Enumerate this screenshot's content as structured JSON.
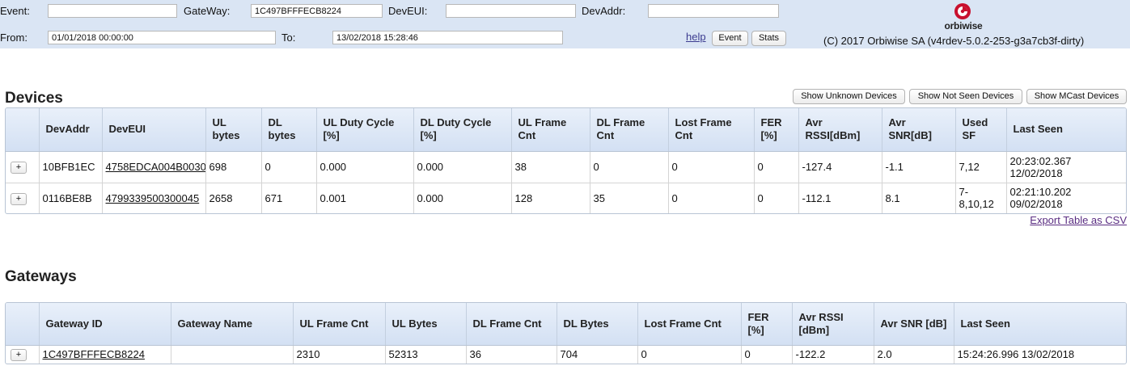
{
  "filters": {
    "event_label": "Event:",
    "event_value": "",
    "gateway_label": "GateWay:",
    "gateway_value": "1C497BFFFECB8224",
    "deveui_label": "DevEUI:",
    "deveui_value": "",
    "devaddr_label": "DevAddr:",
    "devaddr_value": "",
    "from_label": "From:",
    "from_value": "01/01/2018 00:00:00",
    "to_label": "To:",
    "to_value": "13/02/2018 15:28:46",
    "help_label": "help",
    "event_button": "Event",
    "stats_button": "Stats"
  },
  "brand": {
    "logo_text": "orbiwise",
    "copyright": "(C) 2017 Orbiwise SA (v4rdev-5.0.2-253-g3a7cb3f-dirty)",
    "logo_color": "#c8102e",
    "header_bg": "#dae5f4"
  },
  "devices": {
    "title": "Devices",
    "buttons": {
      "unknown": "Show Unknown Devices",
      "not_seen": "Show Not Seen Devices",
      "mcast": "Show MCast Devices"
    },
    "columns": [
      "DevAddr",
      "DevEUI",
      "UL bytes",
      "DL bytes",
      "DL Duty Cycle [%]",
      "DL Duty Cycle [%]",
      "UL Frame Cnt",
      "DL Frame Cnt",
      "Lost Frame Cnt",
      "FER [%]",
      "Avr RSSI[dBm]",
      "Avr SNR[dB]",
      "Used SF",
      "Last Seen"
    ],
    "rows": [
      {
        "expand": "+",
        "devaddr": "10BFB1EC",
        "deveui": "4758EDCA004B0030",
        "ul_bytes": "698",
        "dl_bytes": "0",
        "ul_duty": "0.000",
        "dl_duty": "0.000",
        "ul_frames": "38",
        "dl_frames": "0",
        "lost_frames": "0",
        "fer": "0",
        "rssi": "-127.4",
        "snr": "-1.1",
        "sf": "7,12",
        "last_seen": "20:23:02.367 12/02/2018"
      },
      {
        "expand": "+",
        "devaddr": "0116BE8B",
        "deveui": "4799339500300045",
        "ul_bytes": "2658",
        "dl_bytes": "671",
        "ul_duty": "0.001",
        "dl_duty": "0.000",
        "ul_frames": "128",
        "dl_frames": "35",
        "lost_frames": "0",
        "fer": "0",
        "rssi": "-112.1",
        "snr": "8.1",
        "sf": "7-8,10,12",
        "last_seen": "02:21:10.202 09/02/2018"
      }
    ],
    "export_label": "Export Table as CSV"
  },
  "gateways": {
    "title": "Gateways",
    "columns": [
      "Gateway ID",
      "Gateway Name",
      "UL Frame Cnt",
      "UL Bytes",
      "DL Frame Cnt",
      "DL Bytes",
      "Lost Frame Cnt",
      "FER [%]",
      "Avr RSSI [dBm]",
      "Avr SNR [dB]",
      "Last Seen"
    ],
    "rows": [
      {
        "expand": "+",
        "gateway_id": "1C497BFFFECB8224",
        "gateway_name": "",
        "ul_frames": "2310",
        "ul_bytes": "52313",
        "dl_frames": "36",
        "dl_bytes": "704",
        "lost_frames": "0",
        "fer": "0",
        "rssi": "-122.2",
        "snr": "2.0",
        "last_seen": "15:24:26.996 13/02/2018"
      }
    ]
  }
}
